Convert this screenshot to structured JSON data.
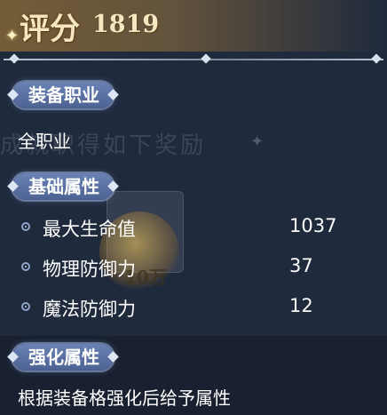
{
  "score": {
    "label": "评分",
    "value": "1819"
  },
  "background": {
    "ghost_text": "成就职得如下奖励",
    "coin_text": "10万"
  },
  "equip_class": {
    "header": "装备职业",
    "value": "全职业"
  },
  "base_attrs": {
    "header": "基础属性",
    "rows": [
      {
        "name": "最大生命值",
        "value": "1037"
      },
      {
        "name": "物理防御力",
        "value": "37"
      },
      {
        "name": "魔法防御力",
        "value": "12"
      }
    ]
  },
  "enhance_attrs": {
    "header": "强化属性",
    "desc": "根据装备格强化后给予属性"
  },
  "colors": {
    "pill": "#5a6fa3",
    "score_gold": "#f6e7c2",
    "bg": "#1f2a3d"
  },
  "icons": {
    "sparkle": "sparkle-icon",
    "bullet": "diamond-bullet-icon"
  }
}
